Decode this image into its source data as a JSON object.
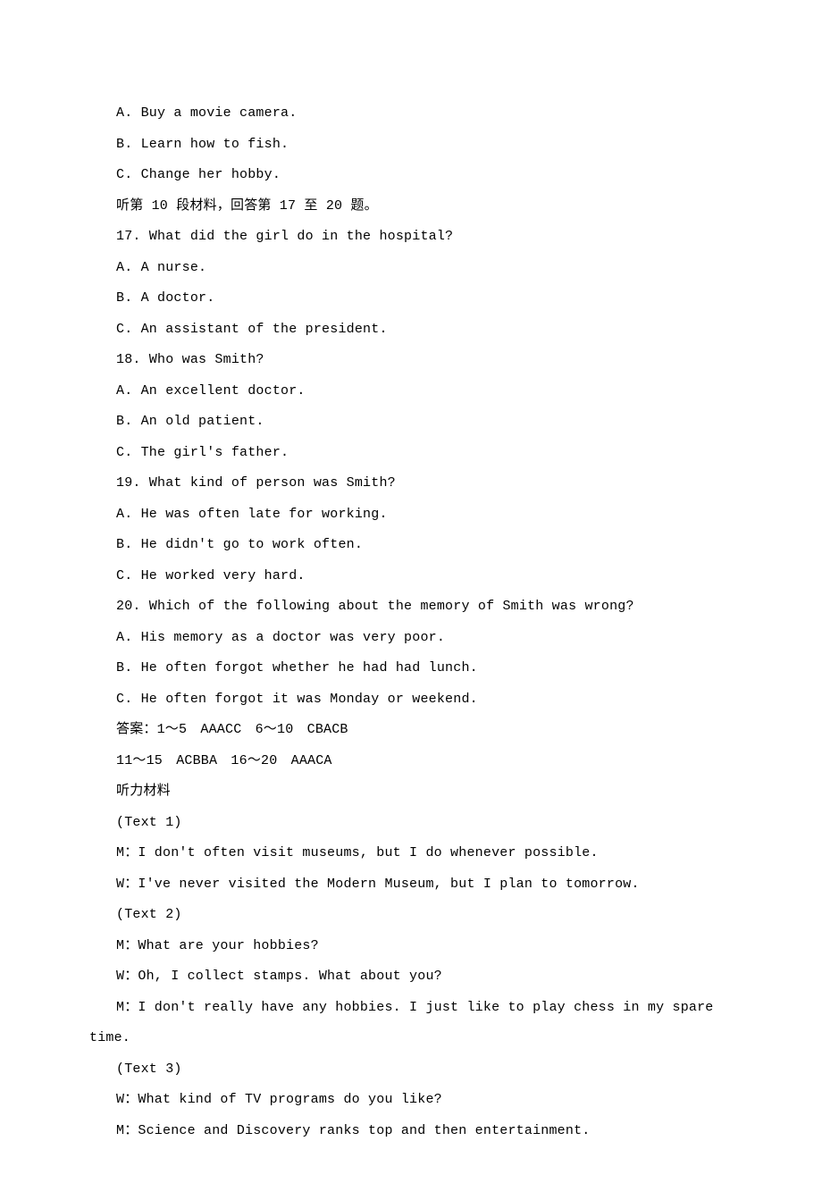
{
  "lines": [
    {
      "text": "A. Buy a movie camera.",
      "indent": true
    },
    {
      "text": "B. Learn how to fish.",
      "indent": true
    },
    {
      "text": "C. Change her hobby.",
      "indent": true
    },
    {
      "text": "听第 10 段材料，回答第 17 至 20 题。",
      "indent": true
    },
    {
      "text": "17. What did the girl do in the hospital?",
      "indent": true
    },
    {
      "text": "A. A nurse.",
      "indent": true
    },
    {
      "text": "B. A doctor.",
      "indent": true
    },
    {
      "text": "C. An assistant of the president.",
      "indent": true
    },
    {
      "text": "18. Who was Smith?",
      "indent": true
    },
    {
      "text": "A. An excellent doctor.",
      "indent": true
    },
    {
      "text": "B. An old patient.",
      "indent": true
    },
    {
      "text": "C. The girl's father.",
      "indent": true
    },
    {
      "text": "19. What kind of person was Smith?",
      "indent": true
    },
    {
      "text": "A. He was often late for working.",
      "indent": true
    },
    {
      "text": "B. He didn't go to work often.",
      "indent": true
    },
    {
      "text": "C. He worked very hard.",
      "indent": true
    },
    {
      "text": "20. Which of the following about the memory of Smith was wrong?",
      "indent": true
    },
    {
      "text": "A. His memory as a doctor was very poor.",
      "indent": true
    },
    {
      "text": "B. He often forgot whether he had had lunch.",
      "indent": true
    },
    {
      "text": "C. He often forgot it was Monday or weekend.",
      "indent": true
    },
    {
      "text": "答案：1～5　AAACC　6～10　CBACB",
      "indent": true
    },
    {
      "text": "11～15　ACBBA　16～20　AAACA",
      "indent": true
    },
    {
      "text": "听力材料",
      "indent": true
    },
    {
      "text": "(Text 1)",
      "indent": true
    },
    {
      "text": "M：I don't often visit museums, but I do whenever possible.",
      "indent": true
    },
    {
      "text": "W：I've never visited the Modern Museum, but I plan to tomorrow.",
      "indent": true
    },
    {
      "text": "(Text 2)",
      "indent": true
    },
    {
      "text": "M：What are your hobbies?",
      "indent": true
    },
    {
      "text": "W：Oh, I collect stamps. What about you?",
      "indent": true
    },
    {
      "text": "M：I don't really have any hobbies. I just like to play chess in my spare time.",
      "indent": true,
      "hang": true
    },
    {
      "text": "(Text 3)",
      "indent": true
    },
    {
      "text": "W：What kind of TV programs do you like?",
      "indent": true
    },
    {
      "text": "M：Science and Discovery ranks top and then entertainment.",
      "indent": true
    }
  ]
}
